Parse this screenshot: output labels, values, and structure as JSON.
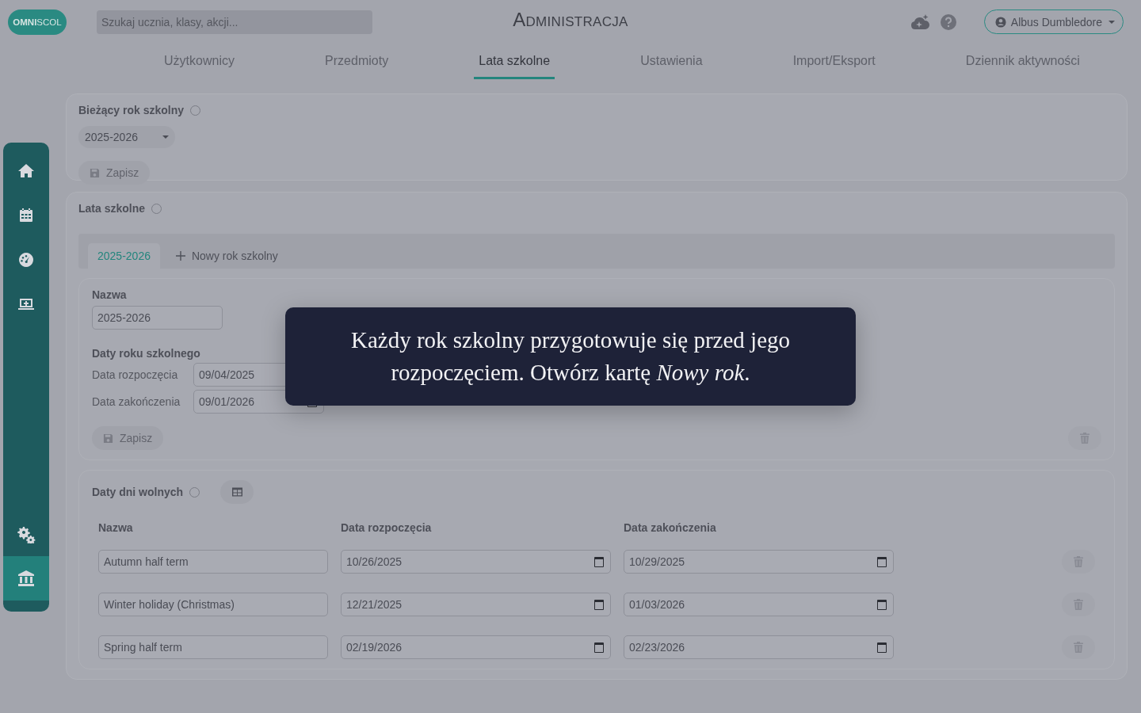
{
  "header": {
    "logo": {
      "part1": "OMNI",
      "part2": "SCOL"
    },
    "search": {
      "placeholder": "Szukaj ucznia, klasy, akcji..."
    },
    "title": "Administracja",
    "user": "Albus Dumbledore"
  },
  "tabs": [
    {
      "label": "Użytkownicy",
      "selected": false
    },
    {
      "label": "Przedmioty",
      "selected": false
    },
    {
      "label": "Lata szkolne",
      "selected": true
    },
    {
      "label": "Ustawienia",
      "selected": false
    },
    {
      "label": "Import/Eksport",
      "selected": false
    },
    {
      "label": "Dziennik aktywności",
      "selected": false
    }
  ],
  "sidebar": {
    "items": [
      {
        "kind": "home",
        "selected": false
      },
      {
        "kind": "calendar",
        "selected": false
      },
      {
        "kind": "gauge",
        "selected": false
      },
      {
        "kind": "laptop",
        "selected": false
      }
    ],
    "bottom_items": [
      {
        "kind": "gears",
        "selected": false
      },
      {
        "kind": "bank",
        "selected": true
      }
    ]
  },
  "current_year": {
    "title": "Bieżący rok szkolny",
    "value": "2025-2026",
    "save": "Zapisz"
  },
  "school_years": {
    "title": "Lata szkolne",
    "tabs": [
      {
        "label": "2025-2026",
        "selected": true
      }
    ],
    "new_tab": "Nowy rok szkolny",
    "name_label": "Nazwa",
    "name_value": "2025-2026",
    "dates_title": "Daty roku szkolnego",
    "start_label": "Data rozpoczęcia",
    "start_value": "09/04/2025",
    "end_label": "Data zakończenia",
    "end_value": "09/01/2026",
    "save": "Zapisz"
  },
  "holidays": {
    "title": "Daty dni wolnych",
    "columns": [
      "Nazwa",
      "Data rozpoczęcia",
      "Data zakończenia"
    ],
    "rows": [
      {
        "name": "Autumn half term",
        "start": "10/26/2025",
        "end": "10/29/2025"
      },
      {
        "name": "Winter holiday (Christmas)",
        "start": "12/21/2025",
        "end": "01/03/2026"
      },
      {
        "name": "Spring half term",
        "start": "02/19/2026",
        "end": "02/23/2026"
      }
    ]
  },
  "tooltip": {
    "text": "Każdy rok szkolny przygotowuje się przed jego rozpoczęciem. Otwórz kartę *Nowy rok*."
  }
}
